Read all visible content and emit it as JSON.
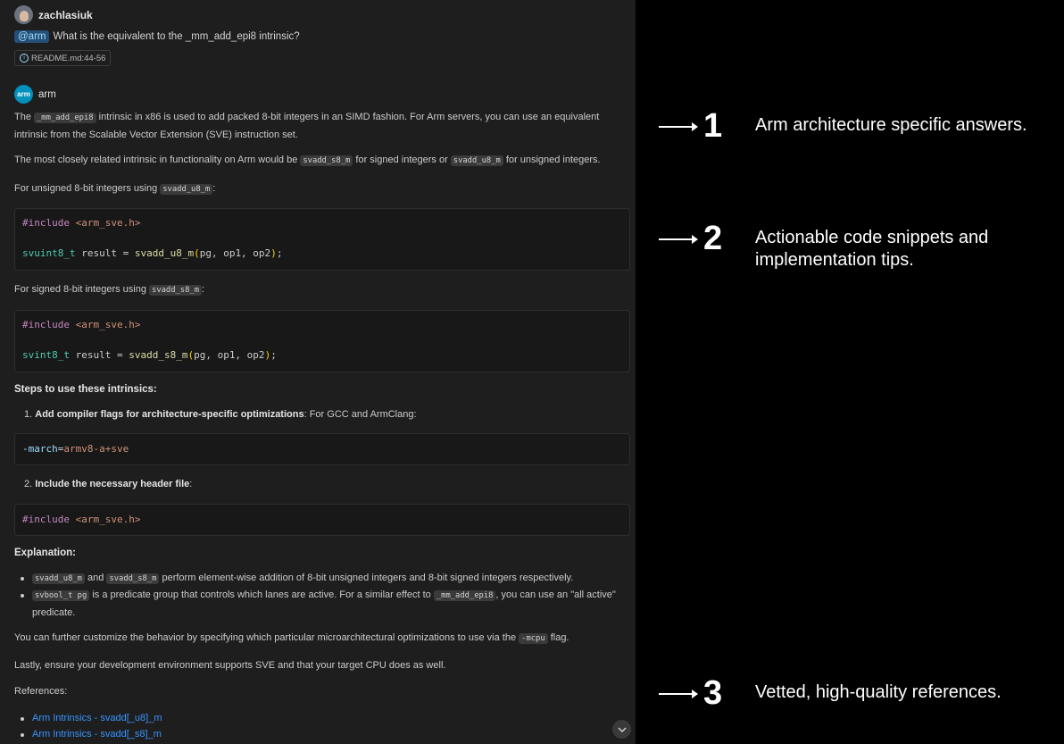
{
  "user": {
    "name": "zachlasiuk",
    "mention": "@arm",
    "question": "What is the equivalent to the _mm_add_epi8 intrinsic?",
    "reference": "README.md:44-56"
  },
  "assistant": {
    "name": "arm",
    "logo": "arm"
  },
  "answer": {
    "p1_a": "The ",
    "p1_code": "_mm_add_epi8",
    "p1_b": " intrinsic in x86 is used to add packed 8-bit integers in an SIMD fashion. For Arm servers, you can use an equivalent intrinsic from the Scalable Vector Extension (SVE) instruction set.",
    "p2_a": "The most closely related intrinsic in functionality on Arm would be ",
    "p2_code1": "svadd_s8_m",
    "p2_b": " for signed integers or ",
    "p2_code2": "svadd_u8_m",
    "p2_c": " for unsigned integers.",
    "p3_a": "For unsigned 8-bit integers using ",
    "p3_code": "svadd_u8_m",
    "p3_b": ":",
    "code1": {
      "include_kw": "#include",
      "include_hdr": "<arm_sve.h>",
      "type": "svuint8_t",
      "var": " result = ",
      "fn": "svadd_u8_m",
      "open": "(",
      "args": "pg, op1, op2",
      "close": ")",
      "end": ";"
    },
    "p4_a": "For signed 8-bit integers using ",
    "p4_code": "svadd_s8_m",
    "p4_b": ":",
    "code2": {
      "include_kw": "#include",
      "include_hdr": "<arm_sve.h>",
      "type": "svint8_t",
      "var": " result = ",
      "fn": "svadd_s8_m",
      "open": "(",
      "args": "pg, op1, op2",
      "close": ")",
      "end": ";"
    },
    "steps_heading": "Steps to use these intrinsics:",
    "step1_num": "1.",
    "step1_bold": "Add compiler flags for architecture-specific optimizations",
    "step1_rest": ": For GCC and ArmClang:",
    "code3": {
      "flag": "-march",
      "eq": "=",
      "value": "armv8-a+sve"
    },
    "step2_num": "2.",
    "step2_bold": "Include the necessary header file",
    "step2_rest": ":",
    "code4": {
      "include_kw": "#include",
      "include_hdr": "<arm_sve.h>"
    },
    "explanation_heading": "Explanation:",
    "b1_code1": "svadd_u8_m",
    "b1_a": " and ",
    "b1_code2": "svadd_s8_m",
    "b1_b": " perform element-wise addition of 8-bit unsigned integers and 8-bit signed integers respectively.",
    "b2_code1": "svbool_t pg",
    "b2_a": " is a predicate group that controls which lanes are active. For a similar effect to ",
    "b2_code2": "_mm_add_epi8",
    "b2_b": ", you can use an \"all active\"",
    "b2_c": "predicate.",
    "p5_a": "You can further customize the behavior by specifying which particular microarchitectural optimizations to use via the ",
    "p5_code": "-mcpu",
    "p5_b": " flag.",
    "p6": "Lastly, ensure your development environment supports SVE and that your target CPU does as well.",
    "refs_heading": "References:",
    "refs": [
      "Arm Intrinsics - svadd[_u8]_m",
      "Arm Intrinsics - svadd[_s8]_m"
    ]
  },
  "annotations": [
    {
      "number": "1",
      "text": "Arm architecture specific answers."
    },
    {
      "number": "2",
      "text": "Actionable code snippets and implementation tips."
    },
    {
      "number": "3",
      "text": "Vetted, high-quality references."
    }
  ],
  "icons": {
    "info": "info-icon",
    "scroll": "chevron-down-icon"
  }
}
